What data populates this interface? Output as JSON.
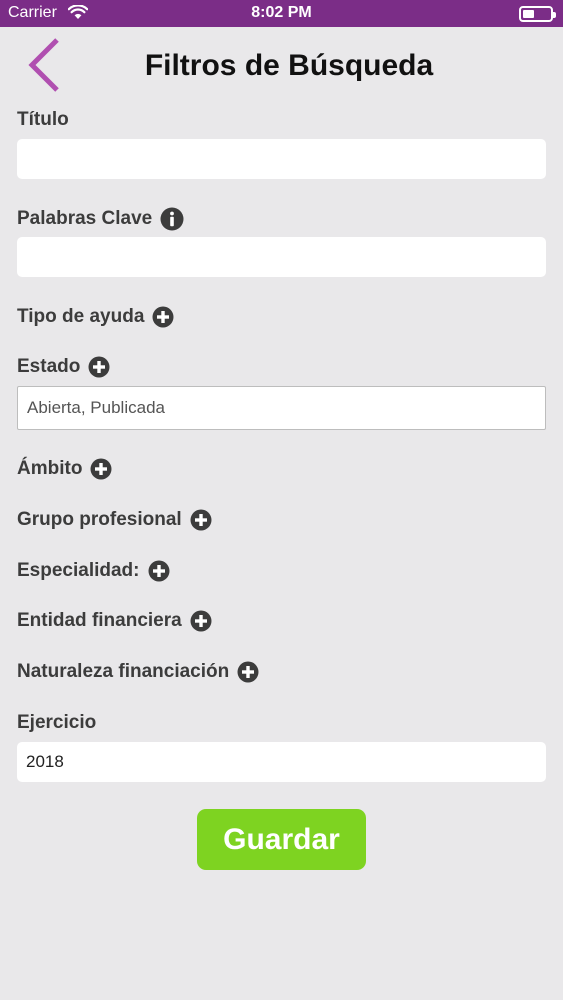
{
  "status_bar": {
    "carrier": "Carrier",
    "time": "8:02 PM",
    "icons": [
      "wifi-icon",
      "battery-icon"
    ]
  },
  "header": {
    "title": "Filtros de Búsqueda",
    "back_icon": "chevron-left-icon"
  },
  "form": {
    "titulo": {
      "label": "Título",
      "value": ""
    },
    "palabras_clave": {
      "label": "Palabras Clave",
      "value": "",
      "icon": "info-icon"
    },
    "tipo_ayuda": {
      "label": "Tipo de ayuda",
      "icon": "plus-circle-icon"
    },
    "estado": {
      "label": "Estado",
      "value": "Abierta, Publicada",
      "icon": "plus-circle-icon"
    },
    "ambito": {
      "label": "Ámbito",
      "icon": "plus-circle-icon"
    },
    "grupo_profesional": {
      "label": "Grupo profesional",
      "icon": "plus-circle-icon"
    },
    "especialidad": {
      "label": "Especialidad:",
      "icon": "plus-circle-icon"
    },
    "entidad_financiera": {
      "label": "Entidad financiera",
      "icon": "plus-circle-icon"
    },
    "naturaleza_financiacion": {
      "label": "Naturaleza financiación",
      "icon": "plus-circle-icon"
    },
    "ejercicio": {
      "label": "Ejercicio",
      "value": "2018"
    }
  },
  "actions": {
    "save_label": "Guardar"
  },
  "colors": {
    "status_bar": "#7b2d87",
    "back_chevron": "#b04fb0",
    "background": "#e9e8ea",
    "save_button": "#7ed321"
  }
}
